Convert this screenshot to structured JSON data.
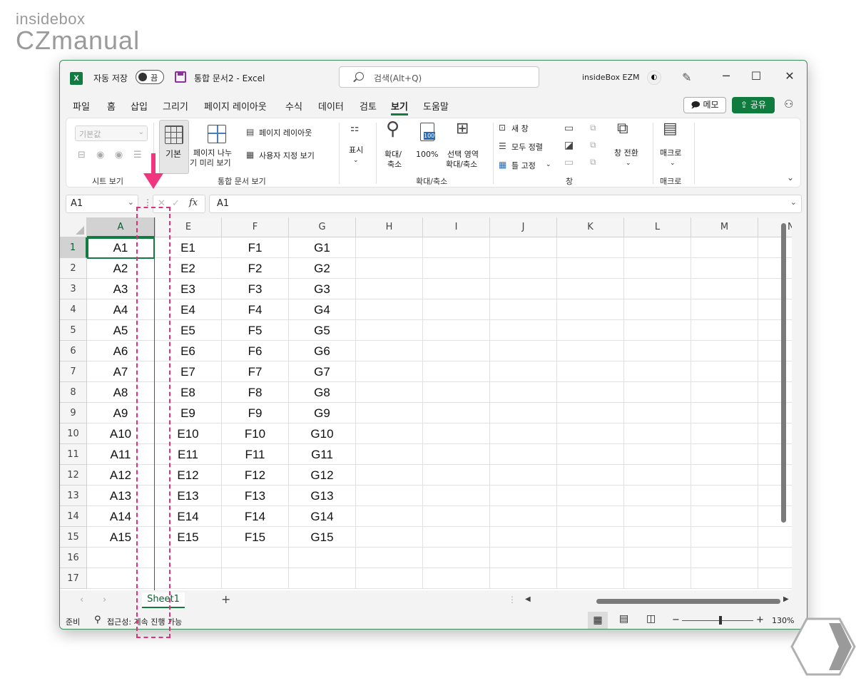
{
  "watermark": {
    "line1": "insidebox",
    "line2": "CZmanual"
  },
  "titlebar": {
    "app_icon": "X",
    "autosave_label": "자동 저장",
    "autosave_state": "끔",
    "document_title": "통합 문서2  -  Excel",
    "search_placeholder": "검색(Alt+Q)",
    "user_name": "insideBox EZM",
    "buttons": {
      "minimize": "─",
      "maximize": "☐",
      "close": "✕"
    }
  },
  "ribbon_tabs": [
    "파일",
    "홈",
    "삽입",
    "그리기",
    "페이지 레이아웃",
    "수식",
    "데이터",
    "검토",
    "보기",
    "도움말"
  ],
  "active_tab": "보기",
  "ribbon_actions": {
    "memo": "메모",
    "share": "공유"
  },
  "ribbon": {
    "sheet_view": {
      "dropdown_value": "기본값",
      "label": "시트 보기"
    },
    "workbook_views": {
      "normal": "기본",
      "page_break_preview_line1": "페이지 나누",
      "page_break_preview_line2": "기 미리 보기",
      "page_layout": "페이지 레이아웃",
      "custom_views": "사용자 지정 보기",
      "label": "통합 문서 보기"
    },
    "show": {
      "label": "표시"
    },
    "zoom": {
      "zoom_line1": "확대/",
      "zoom_line2": "축소",
      "zoom100": "100%",
      "zoom_sel_line1": "선택 영역",
      "zoom_sel_line2": "확대/축소",
      "label": "확대/축소"
    },
    "window": {
      "new_window": "새 창",
      "arrange_all": "모두 정렬",
      "freeze_panes": "틀 고정",
      "switch_windows": "창 전환",
      "label": "창"
    },
    "macros": {
      "macros": "매크로",
      "label": "매크로"
    }
  },
  "formula_bar": {
    "name_box": "A1",
    "fx": "fx",
    "content": "A1"
  },
  "columns": [
    "A",
    "E",
    "F",
    "G",
    "H",
    "I",
    "J",
    "K",
    "L",
    "M",
    "N"
  ],
  "rows": [
    {
      "n": "1",
      "a": "A1",
      "e": "E1",
      "f": "F1",
      "g": "G1"
    },
    {
      "n": "2",
      "a": "A2",
      "e": "E2",
      "f": "F2",
      "g": "G2"
    },
    {
      "n": "3",
      "a": "A3",
      "e": "E3",
      "f": "F3",
      "g": "G3"
    },
    {
      "n": "4",
      "a": "A4",
      "e": "E4",
      "f": "F4",
      "g": "G4"
    },
    {
      "n": "5",
      "a": "A5",
      "e": "E5",
      "f": "F5",
      "g": "G5"
    },
    {
      "n": "6",
      "a": "A6",
      "e": "E6",
      "f": "F6",
      "g": "G6"
    },
    {
      "n": "7",
      "a": "A7",
      "e": "E7",
      "f": "F7",
      "g": "G7"
    },
    {
      "n": "8",
      "a": "A8",
      "e": "E8",
      "f": "F8",
      "g": "G8"
    },
    {
      "n": "9",
      "a": "A9",
      "e": "E9",
      "f": "F9",
      "g": "G9"
    },
    {
      "n": "10",
      "a": "A10",
      "e": "E10",
      "f": "F10",
      "g": "G10"
    },
    {
      "n": "11",
      "a": "A11",
      "e": "E11",
      "f": "F11",
      "g": "G11"
    },
    {
      "n": "12",
      "a": "A12",
      "e": "E12",
      "f": "F12",
      "g": "G12"
    },
    {
      "n": "13",
      "a": "A13",
      "e": "E13",
      "f": "F13",
      "g": "G13"
    },
    {
      "n": "14",
      "a": "A14",
      "e": "E14",
      "f": "F14",
      "g": "G14"
    },
    {
      "n": "15",
      "a": "A15",
      "e": "E15",
      "f": "F15",
      "g": "G15"
    },
    {
      "n": "16",
      "a": "",
      "e": "",
      "f": "",
      "g": ""
    },
    {
      "n": "17",
      "a": "",
      "e": "",
      "f": "",
      "g": ""
    }
  ],
  "sheet_tabs": {
    "sheet1": "Sheet1",
    "add": "+"
  },
  "status": {
    "ready": "준비",
    "accessibility": "접근성: 계속 진행 가능",
    "zoom_minus": "−",
    "zoom_plus": "+",
    "zoom_percent": "130%"
  },
  "colors": {
    "accent": "#107c41",
    "annotation": "#f2357f"
  }
}
